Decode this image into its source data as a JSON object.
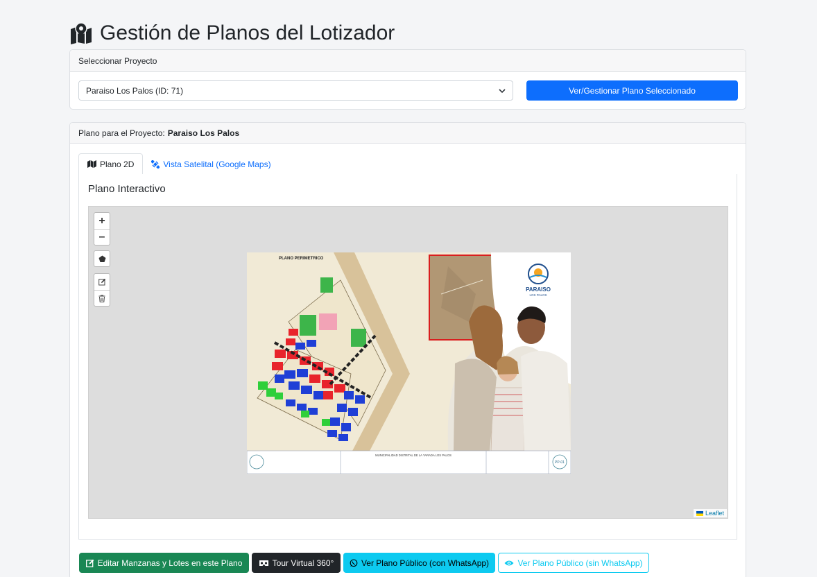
{
  "page": {
    "title": "Gestión de Planos del Lotizador"
  },
  "project_card": {
    "header": "Seleccionar Proyecto",
    "selected_project": "Paraiso Los Palos (ID: 71)",
    "view_button": "Ver/Gestionar Plano Seleccionado"
  },
  "plan_card": {
    "header_prefix": "Plano para el Proyecto:",
    "project_name": "Paraiso Los Palos",
    "tabs": [
      {
        "label": "Plano 2D",
        "icon": "map-icon",
        "active": true
      },
      {
        "label": "Vista Satelital (Google Maps)",
        "icon": "satellite-icon",
        "active": false
      }
    ],
    "pane_title": "Plano Interactivo",
    "map": {
      "controls": [
        "zoom-in",
        "zoom-out",
        "draw-polygon",
        "edit-layers",
        "delete-layers"
      ],
      "zoom_in": "+",
      "zoom_out": "–",
      "attribution": "Leaflet",
      "overlay_image": {
        "plan_title": "PLANO PERIMETRICO",
        "logo_name": "PARAISO",
        "logo_sub": "LOS PALOS",
        "footer_text": "MUNICIPALIDAD DISTRITAL DE LA YARADA LOS PALOS",
        "sheet_label": "PP-01"
      }
    }
  },
  "actions": [
    {
      "label": "Editar Manzanas y Lotes en este Plano",
      "icon": "edit-icon",
      "style": "success"
    },
    {
      "label": "Tour Virtual 360°",
      "icon": "vr-icon",
      "style": "dark"
    },
    {
      "label": "Ver Plano Público (con WhatsApp)",
      "icon": "whatsapp-icon",
      "style": "info"
    },
    {
      "label": "Ver Plano Público (sin WhatsApp)",
      "icon": "eye-icon",
      "style": "outline-info"
    }
  ],
  "colors": {
    "primary": "#0d6efd",
    "success": "#198754",
    "dark": "#212529",
    "info": "#0dcaf0",
    "lot_red": "#e8242c",
    "lot_blue": "#1f3fd6",
    "lot_green": "#2fcf3a"
  }
}
